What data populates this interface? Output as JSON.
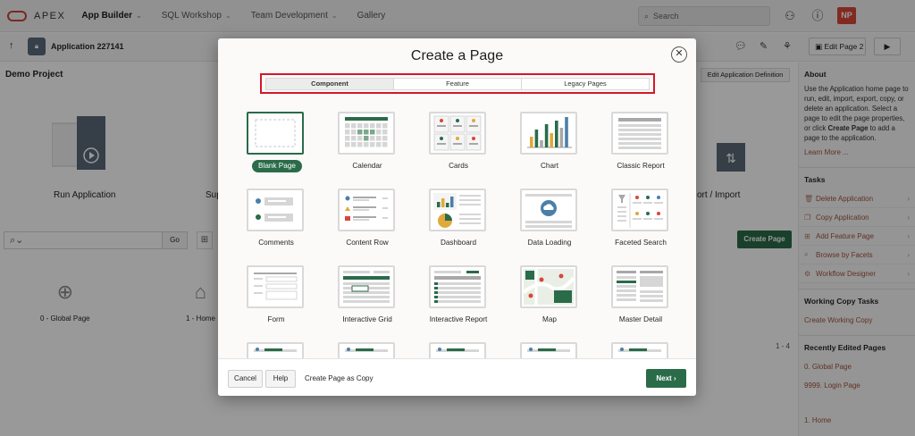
{
  "topbar": {
    "brand": "APEX",
    "nav": [
      {
        "label": "App Builder",
        "active": true
      },
      {
        "label": "SQL Workshop"
      },
      {
        "label": "Team Development"
      },
      {
        "label": "Gallery"
      }
    ],
    "search_placeholder": "Search",
    "avatar_initials": "NP"
  },
  "appbar": {
    "app_name": "Application 227141",
    "edit_page_label": "Edit Page 2"
  },
  "background": {
    "project_title": "Demo Project",
    "edit_def_label": "Edit Application Definition",
    "hero": {
      "run_label": "Run Application",
      "supporting_label": "Sup",
      "export_label": "ort / Import"
    },
    "go_label": "Go",
    "create_page_label": "Create Page",
    "pages": [
      "0 - Global Page",
      "1 - Home"
    ],
    "pager": "1 - 4"
  },
  "sidebar": {
    "about_head": "About",
    "about_text_1": "Use the Application home page to run, edit, import, export, copy, or delete an application. Select a page to edit the page properties, or click ",
    "about_bold": "Create Page",
    "about_text_2": " to add a page to the application.",
    "learn_more": "Learn More ...",
    "tasks_head": "Tasks",
    "tasks": [
      "Delete Application",
      "Copy Application",
      "Add Feature Page",
      "Browse by Facets",
      "Workflow Designer"
    ],
    "wc_head": "Working Copy Tasks",
    "wc_link": "Create Working Copy",
    "recent_head": "Recently Edited Pages",
    "recent": [
      "0. Global Page",
      "9999. Login Page",
      "1. Home"
    ]
  },
  "modal": {
    "title": "Create a Page",
    "tabs": [
      {
        "label": "Component",
        "active": true
      },
      {
        "label": "Feature"
      },
      {
        "label": "Legacy Pages"
      }
    ],
    "tiles": [
      {
        "label": "Blank Page",
        "icon": "blank-page-icon",
        "selected": true
      },
      {
        "label": "Calendar",
        "icon": "calendar-icon"
      },
      {
        "label": "Cards",
        "icon": "cards-icon"
      },
      {
        "label": "Chart",
        "icon": "chart-icon"
      },
      {
        "label": "Classic Report",
        "icon": "classic-report-icon"
      },
      {
        "label": "Comments",
        "icon": "comments-icon"
      },
      {
        "label": "Content Row",
        "icon": "content-row-icon"
      },
      {
        "label": "Dashboard",
        "icon": "dashboard-icon"
      },
      {
        "label": "Data Loading",
        "icon": "data-loading-icon"
      },
      {
        "label": "Faceted Search",
        "icon": "faceted-search-icon"
      },
      {
        "label": "Form",
        "icon": "form-icon"
      },
      {
        "label": "Interactive Grid",
        "icon": "interactive-grid-icon"
      },
      {
        "label": "Interactive Report",
        "icon": "interactive-report-icon"
      },
      {
        "label": "Map",
        "icon": "map-icon"
      },
      {
        "label": "Master Detail",
        "icon": "master-detail-icon"
      },
      {
        "label": "",
        "icon": "partial-tile-icon"
      },
      {
        "label": "",
        "icon": "partial-tile-icon"
      },
      {
        "label": "",
        "icon": "partial-tile-icon"
      },
      {
        "label": "",
        "icon": "partial-tile-icon"
      },
      {
        "label": "",
        "icon": "partial-tile-icon"
      }
    ],
    "cancel_label": "Cancel",
    "help_label": "Help",
    "copy_label": "Create Page as Copy",
    "next_label": "Next"
  },
  "colors": {
    "accent_green": "#2a6b49",
    "highlight_red": "#d2192a",
    "oracle_red": "#c74634"
  }
}
